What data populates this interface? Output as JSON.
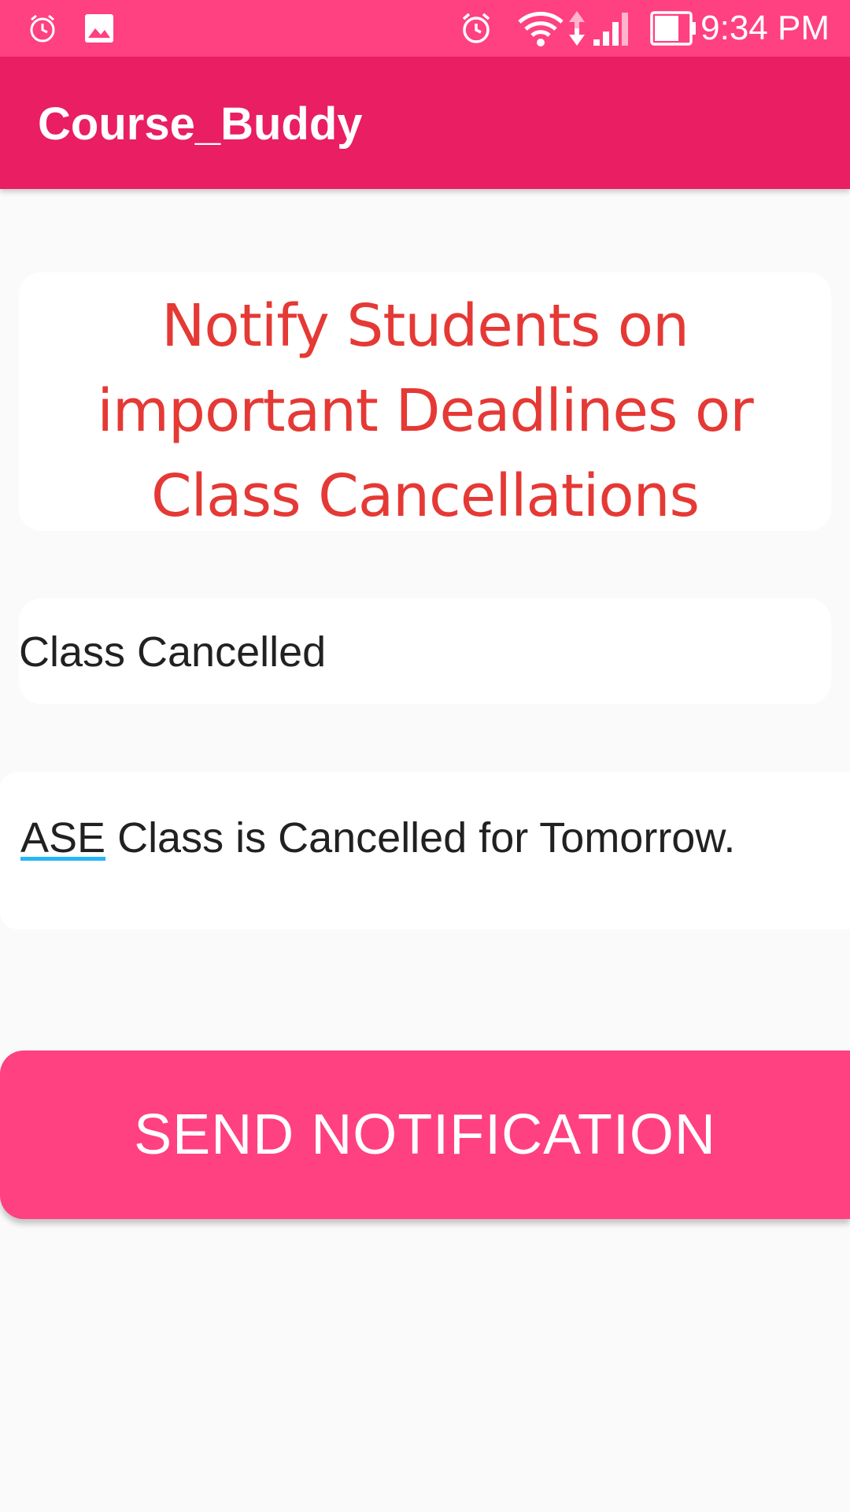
{
  "status_bar": {
    "time": "9:34 PM",
    "left_icons": [
      "alarm-clock-icon",
      "image-icon"
    ],
    "right_icons": [
      "alarm-clock-icon",
      "wifi-icon",
      "data-arrows-icon",
      "cell-signal-icon",
      "battery-icon"
    ]
  },
  "app_bar": {
    "title": "Course_Buddy",
    "color": "#e91e63"
  },
  "heading": {
    "text": "Notify Students on important Deadlines or Class Cancellations",
    "color": "#e53935"
  },
  "notification_title": {
    "value": "Class Cancelled"
  },
  "notification_message": {
    "underlined_word": "ASE",
    "rest": " Class is Cancelled for Tomorrow."
  },
  "send_button": {
    "label": "SEND NOTIFICATION",
    "color": "#ff4081"
  },
  "colors": {
    "status_bar": "#ff4081",
    "background": "#fafafa",
    "text": "#212121",
    "spellcheck_underline": "#29b6f6"
  }
}
